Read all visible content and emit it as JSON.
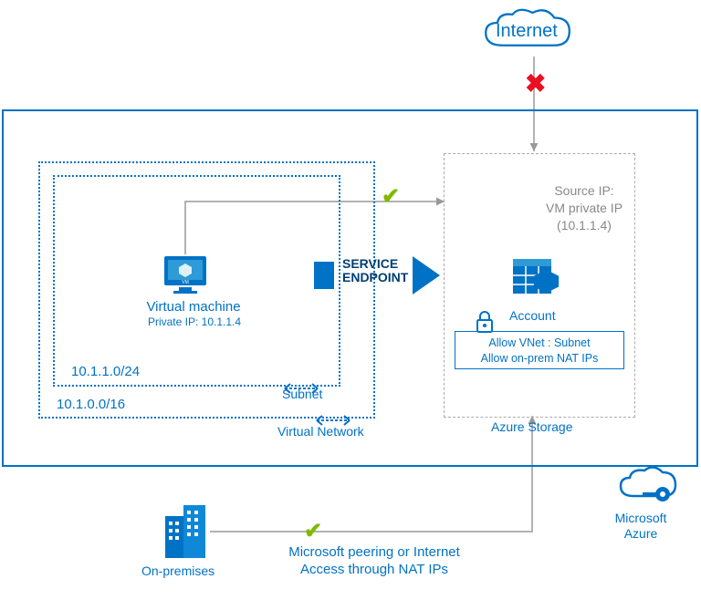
{
  "internet": {
    "label": "Internet"
  },
  "vnet": {
    "cidr": "10.1.0.0/16",
    "label": "Virtual Network"
  },
  "subnet": {
    "cidr": "10.1.1.0/24",
    "label": "Subnet"
  },
  "vm": {
    "title": "Virtual machine",
    "ip_label": "Private IP: 10.1.1.4"
  },
  "service_endpoint": {
    "label": "SERVICE ENDPOINT"
  },
  "storage": {
    "box_label": "Azure Storage",
    "source_ip_line1": "Source IP:",
    "source_ip_line2": "VM private IP",
    "source_ip_line3": "(10.1.1.4)",
    "account_label": "Account",
    "allow_line1": "Allow VNet : Subnet",
    "allow_line2": "Allow on-prem NAT IPs"
  },
  "azure_logo": {
    "line1": "Microsoft",
    "line2": "Azure"
  },
  "onprem": {
    "label": "On-premises"
  },
  "peering": {
    "line1": "Microsoft peering or Internet",
    "line2": "Access through NAT IPs"
  }
}
